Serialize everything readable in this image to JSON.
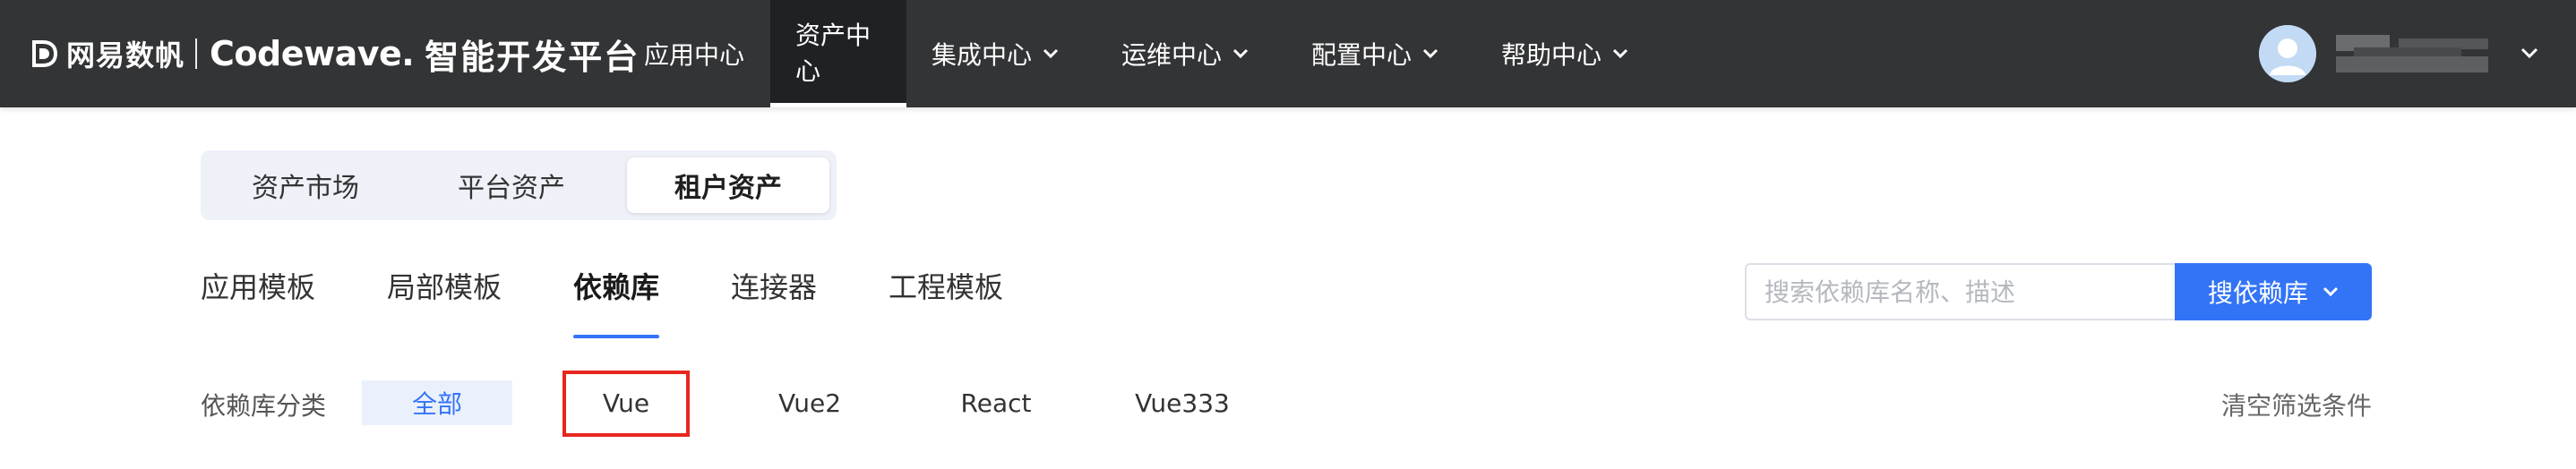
{
  "brand": {
    "company": "网易数帆",
    "product": "Codewave.",
    "title": "智能开发平台"
  },
  "nav": [
    {
      "label": "应用中心",
      "dropdown": false,
      "active": false
    },
    {
      "label": "资产中心",
      "dropdown": false,
      "active": true
    },
    {
      "label": "集成中心",
      "dropdown": true,
      "active": false
    },
    {
      "label": "运维中心",
      "dropdown": true,
      "active": false
    },
    {
      "label": "配置中心",
      "dropdown": true,
      "active": false
    },
    {
      "label": "帮助中心",
      "dropdown": true,
      "active": false
    }
  ],
  "segments": [
    {
      "label": "资产市场",
      "active": false
    },
    {
      "label": "平台资产",
      "active": false
    },
    {
      "label": "租户资产",
      "active": true
    }
  ],
  "subtabs": [
    {
      "label": "应用模板",
      "active": false
    },
    {
      "label": "局部模板",
      "active": false
    },
    {
      "label": "依赖库",
      "active": true
    },
    {
      "label": "连接器",
      "active": false
    },
    {
      "label": "工程模板",
      "active": false
    }
  ],
  "search": {
    "placeholder": "搜索依赖库名称、描述",
    "button_label": "搜依赖库"
  },
  "filter": {
    "label": "依赖库分类",
    "options": [
      {
        "label": "全部",
        "active": true
      },
      {
        "label": "Vue",
        "active": false,
        "highlighted": true
      },
      {
        "label": "Vue2",
        "active": false
      },
      {
        "label": "React",
        "active": false
      },
      {
        "label": "Vue333",
        "active": false
      }
    ],
    "clear_label": "清空筛选条件"
  },
  "colors": {
    "topbar": "#333436",
    "accent": "#3374f6",
    "highlight": "#e8261f"
  },
  "icons": {
    "chevron": "chevron-down-icon",
    "user_menu": "chevron-down-icon",
    "avatar": "avatar"
  }
}
